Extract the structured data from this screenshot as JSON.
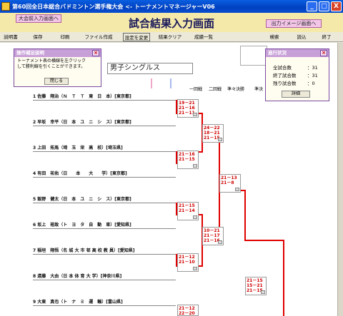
{
  "window": {
    "title": "第60回全日本総合バドミントン選手権大会 <- トーナメントマネージャーV06",
    "min": "_",
    "max": "□",
    "close": "X"
  },
  "header": {
    "pre_input_button": "大会前入力画面へ",
    "title": "試合結果入力画面",
    "output_image_button": "出力イメージ画面へ"
  },
  "menu": {
    "manual": "説明書",
    "save": "保存",
    "print": "印刷",
    "file": "ファイル作成",
    "settings": "設定を変更",
    "clear": "結果クリア",
    "results": "成績一覧",
    "search": "検索",
    "load": "読込",
    "exit": "終了"
  },
  "help_popup": {
    "title": "操作補足説明",
    "line1": "トーナメント表の横線を左クリック",
    "line2": "して勝利線を引くことができます。",
    "close_button": "閉じる"
  },
  "status_popup": {
    "title": "進行状況",
    "total_label": "全試合数",
    "total_value": "：31",
    "done_label": "終了試合数",
    "done_value": "：31",
    "remain_label": "残り試合数",
    "remain_value": "：0",
    "detail_button": "詳細"
  },
  "event": "男子シングルス",
  "rounds": {
    "r1": "一回戦",
    "r2": "二回戦",
    "qf": "準々決勝",
    "sf": "準決"
  },
  "players": [
    "1 佐藤　翔治（Ｎ　Ｔ　Ｔ　東　日　本）[東京都]",
    "2 早坂　幸平（日　本　ユ　ニ　シ　ス）[東京都]",
    "3 上田　拓馬（埼　玉　栄　高　校）[埼玉県]",
    "4 有田　祐佑（日　　本　　大　　学）[東京都]",
    "5 飯野　健太（日　本　ユ　ニ　シ　ス）[東京都]",
    "6 坂上　裕致（ト　ヨ　タ　自　動　車）[愛知県]",
    "7 稲垣　翔悟（名 城 大 市 邨 高 校 教 員）[愛知県]",
    "8 遠藤　大由（日 本 体 育 大 学）[神奈川県]",
    "9 大東　真也（ト　ナ　ミ　運　輸）[富山県]"
  ],
  "scores": {
    "m1": [
      "19－21",
      "21－16",
      "21－11"
    ],
    "m2": [
      "21－16",
      "21－15"
    ],
    "m3": [
      "21－15",
      "21－14"
    ],
    "m4": [
      "21－12",
      "21－10"
    ],
    "m5": [
      "21－12",
      "22－20"
    ],
    "q1": [
      "24－22",
      "18－21",
      "21－15"
    ],
    "q2": [
      "10－21",
      "21－17",
      "21－16"
    ],
    "s1": [
      "21－13",
      "21－8"
    ],
    "f1": [
      "21－15",
      "15－21",
      "21－15"
    ]
  }
}
